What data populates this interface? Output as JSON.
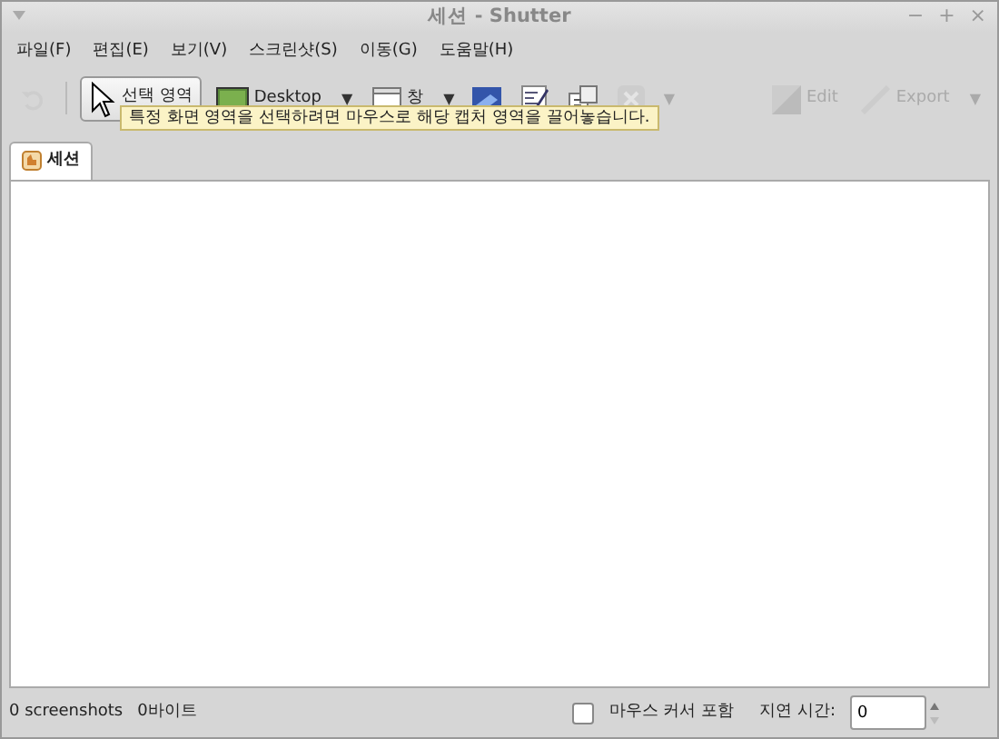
{
  "window": {
    "title": "세션 - Shutter",
    "buttons": [
      "−",
      "+",
      "×"
    ]
  },
  "menu": [
    "파일(F)",
    "편집(E)",
    "보기(V)",
    "스크린샷(S)",
    "이동(G)",
    "도움말(H)"
  ],
  "toolbar": [
    {
      "kind": "icon",
      "disabled": true
    },
    {
      "kind": "separator"
    },
    {
      "kind": "button",
      "label": "선택 영역",
      "disabled": false,
      "pressed": true
    },
    {
      "kind": "button",
      "label": "Desktop",
      "disabled": false,
      "pressed": false
    },
    {
      "kind": "arrow",
      "label": "▼",
      "disabled": false
    },
    {
      "kind": "button",
      "label": "창",
      "disabled": false,
      "pressed": false
    },
    {
      "kind": "arrow",
      "label": "▼",
      "disabled": false
    },
    {
      "kind": "icon",
      "disabled": false
    },
    {
      "kind": "icon",
      "disabled": false
    },
    {
      "kind": "icon",
      "disabled": false
    },
    {
      "kind": "icon",
      "disabled": true
    },
    {
      "kind": "arrow",
      "label": "▼",
      "disabled": true
    },
    {
      "kind": "spacer"
    },
    {
      "kind": "button",
      "label": "Edit",
      "disabled": true,
      "pressed": false
    },
    {
      "kind": "button",
      "label": "Export",
      "disabled": true,
      "pressed": false
    },
    {
      "kind": "arrow",
      "label": "▼",
      "disabled": true
    }
  ],
  "tooltip": "특정 화면 영역을 선택하려면 마우스로 해당 캡처 영역을 끌어놓습니다.",
  "tabs": [
    {
      "label": "세션",
      "selected": true
    }
  ],
  "status_bar": {
    "count": "0 screenshots",
    "size": "0바이트",
    "cursor_checkbox": {
      "label": "마우스 커서 포함",
      "checked": false
    },
    "delay": {
      "label": "지연 시간:",
      "value": "0"
    }
  }
}
